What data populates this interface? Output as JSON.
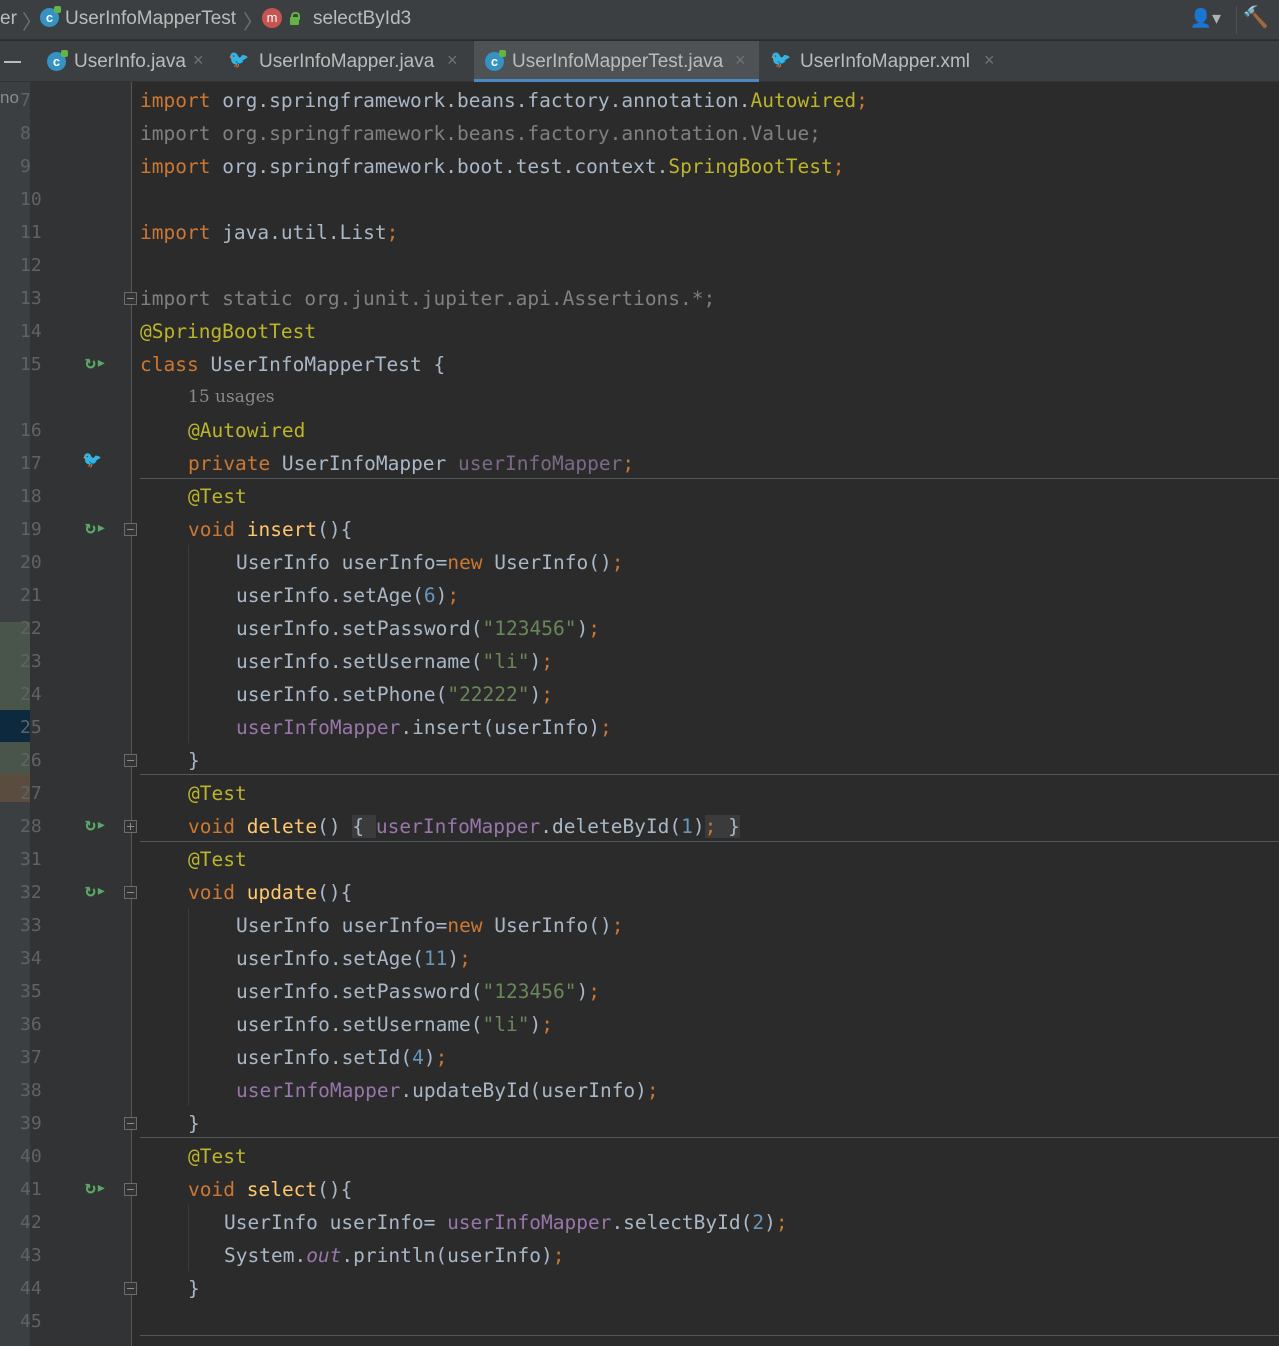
{
  "breadcrumb": {
    "items": [
      "er",
      "UserInfoMapperTest",
      "selectById3"
    ]
  },
  "tabs": [
    {
      "label": "UserInfo.java",
      "icon": "class-icon",
      "active": false
    },
    {
      "label": "UserInfoMapper.java",
      "icon": "mapper-interface-icon",
      "active": false
    },
    {
      "label": "UserInfoMapperTest.java",
      "icon": "class-icon",
      "active": true
    },
    {
      "label": "UserInfoMapper.xml",
      "icon": "mybatis-xml-icon",
      "active": false
    }
  ],
  "left_strip": {
    "label": "no"
  },
  "gutter": {
    "line_numbers": [
      "7",
      "8",
      "9",
      "10",
      "11",
      "12",
      "13",
      "14",
      "15",
      "16",
      "17",
      "18",
      "19",
      "20",
      "21",
      "22",
      "23",
      "24",
      "25",
      "26",
      "27",
      "28",
      "31",
      "32",
      "33",
      "34",
      "35",
      "36",
      "37",
      "38",
      "39",
      "40",
      "41",
      "42",
      "43",
      "44",
      "45"
    ]
  },
  "code": {
    "l7": {
      "kw": "import",
      "path": " org.springframework.beans.factory.annotation.",
      "cls": "Autowired",
      "semi": ";"
    },
    "l8": {
      "text": "import org.springframework.beans.factory.annotation.Value;"
    },
    "l9": {
      "kw": "import",
      "path": " org.springframework.boot.test.context.",
      "cls": "SpringBootTest",
      "semi": ";"
    },
    "l11": {
      "kw": "import",
      "path": " java.util.List",
      "semi": ";"
    },
    "l13": {
      "text": "import static org.junit.jupiter.api.Assertions.*;"
    },
    "l14": {
      "ann": "@SpringBootTest"
    },
    "l15": {
      "kw": "class",
      "rest": " UserInfoMapperTest {"
    },
    "usages": "15 usages",
    "l16": {
      "ann": "@Autowired"
    },
    "l17": {
      "kw": "private",
      "type": " UserInfoMapper ",
      "field": "userInfoMapper",
      "semi": ";"
    },
    "l18": {
      "ann": "@Test"
    },
    "l19": {
      "kw": "void",
      "sp": " ",
      "fn": "insert",
      "rest": "(){"
    },
    "l20": {
      "a": "UserInfo userInfo=",
      "kw": "new",
      "b": " UserInfo()",
      "semi": ";"
    },
    "l21": {
      "a": "userInfo.setAge(",
      "num": "6",
      "b": ")",
      "semi": ";"
    },
    "l22": {
      "a": "userInfo.setPassword(",
      "str": "\"123456\"",
      "b": ")",
      "semi": ";"
    },
    "l23": {
      "a": "userInfo.setUsername(",
      "str": "\"li\"",
      "b": ")",
      "semi": ";"
    },
    "l24": {
      "a": "userInfo.setPhone(",
      "str": "\"22222\"",
      "b": ")",
      "semi": ";"
    },
    "l25": {
      "field": "userInfoMapper",
      "b": ".insert(userInfo)",
      "semi": ";"
    },
    "l26": {
      "text": "}"
    },
    "l27": {
      "ann": "@Test"
    },
    "l28": {
      "kw": "void",
      "sp": " ",
      "fn": "delete",
      "p": "() ",
      "ob": "{ ",
      "field": "userInfoMapper",
      "b": ".deleteById(",
      "num": "1",
      "c": ")",
      "semi": ";",
      "cb": " }"
    },
    "l31": {
      "ann": "@Test"
    },
    "l32": {
      "kw": "void",
      "sp": " ",
      "fn": "update",
      "rest": "(){"
    },
    "l33": {
      "a": "UserInfo userInfo=",
      "kw": "new",
      "b": " UserInfo()",
      "semi": ";"
    },
    "l34": {
      "a": "userInfo.setAge(",
      "num": "11",
      "b": ")",
      "semi": ";"
    },
    "l35": {
      "a": "userInfo.setPassword(",
      "str": "\"123456\"",
      "b": ")",
      "semi": ";"
    },
    "l36": {
      "a": "userInfo.setUsername(",
      "str": "\"li\"",
      "b": ")",
      "semi": ";"
    },
    "l37": {
      "a": "userInfo.setId(",
      "num": "4",
      "b": ")",
      "semi": ";"
    },
    "l38": {
      "field": "userInfoMapper",
      "b": ".updateById(userInfo)",
      "semi": ";"
    },
    "l39": {
      "text": "}"
    },
    "l40": {
      "ann": "@Test"
    },
    "l41": {
      "kw": "void",
      "sp": " ",
      "fn": "select",
      "rest": "(){"
    },
    "l42": {
      "a": "UserInfo userInfo= ",
      "field": "userInfoMapper",
      "b": ".selectById(",
      "num": "2",
      "c": ")",
      "semi": ";"
    },
    "l43": {
      "a": "System.",
      "out": "out",
      "b": ".println(userInfo)",
      "semi": ";"
    },
    "l44": {
      "text": "}"
    }
  },
  "colors": {
    "keyword": "#cc7832",
    "annotation": "#bbb529",
    "field": "#9876aa",
    "number": "#6897bb",
    "string": "#6a8759",
    "method_decl": "#ffc66d",
    "default_text": "#a9b7c6",
    "run_icon": "#59a869"
  }
}
